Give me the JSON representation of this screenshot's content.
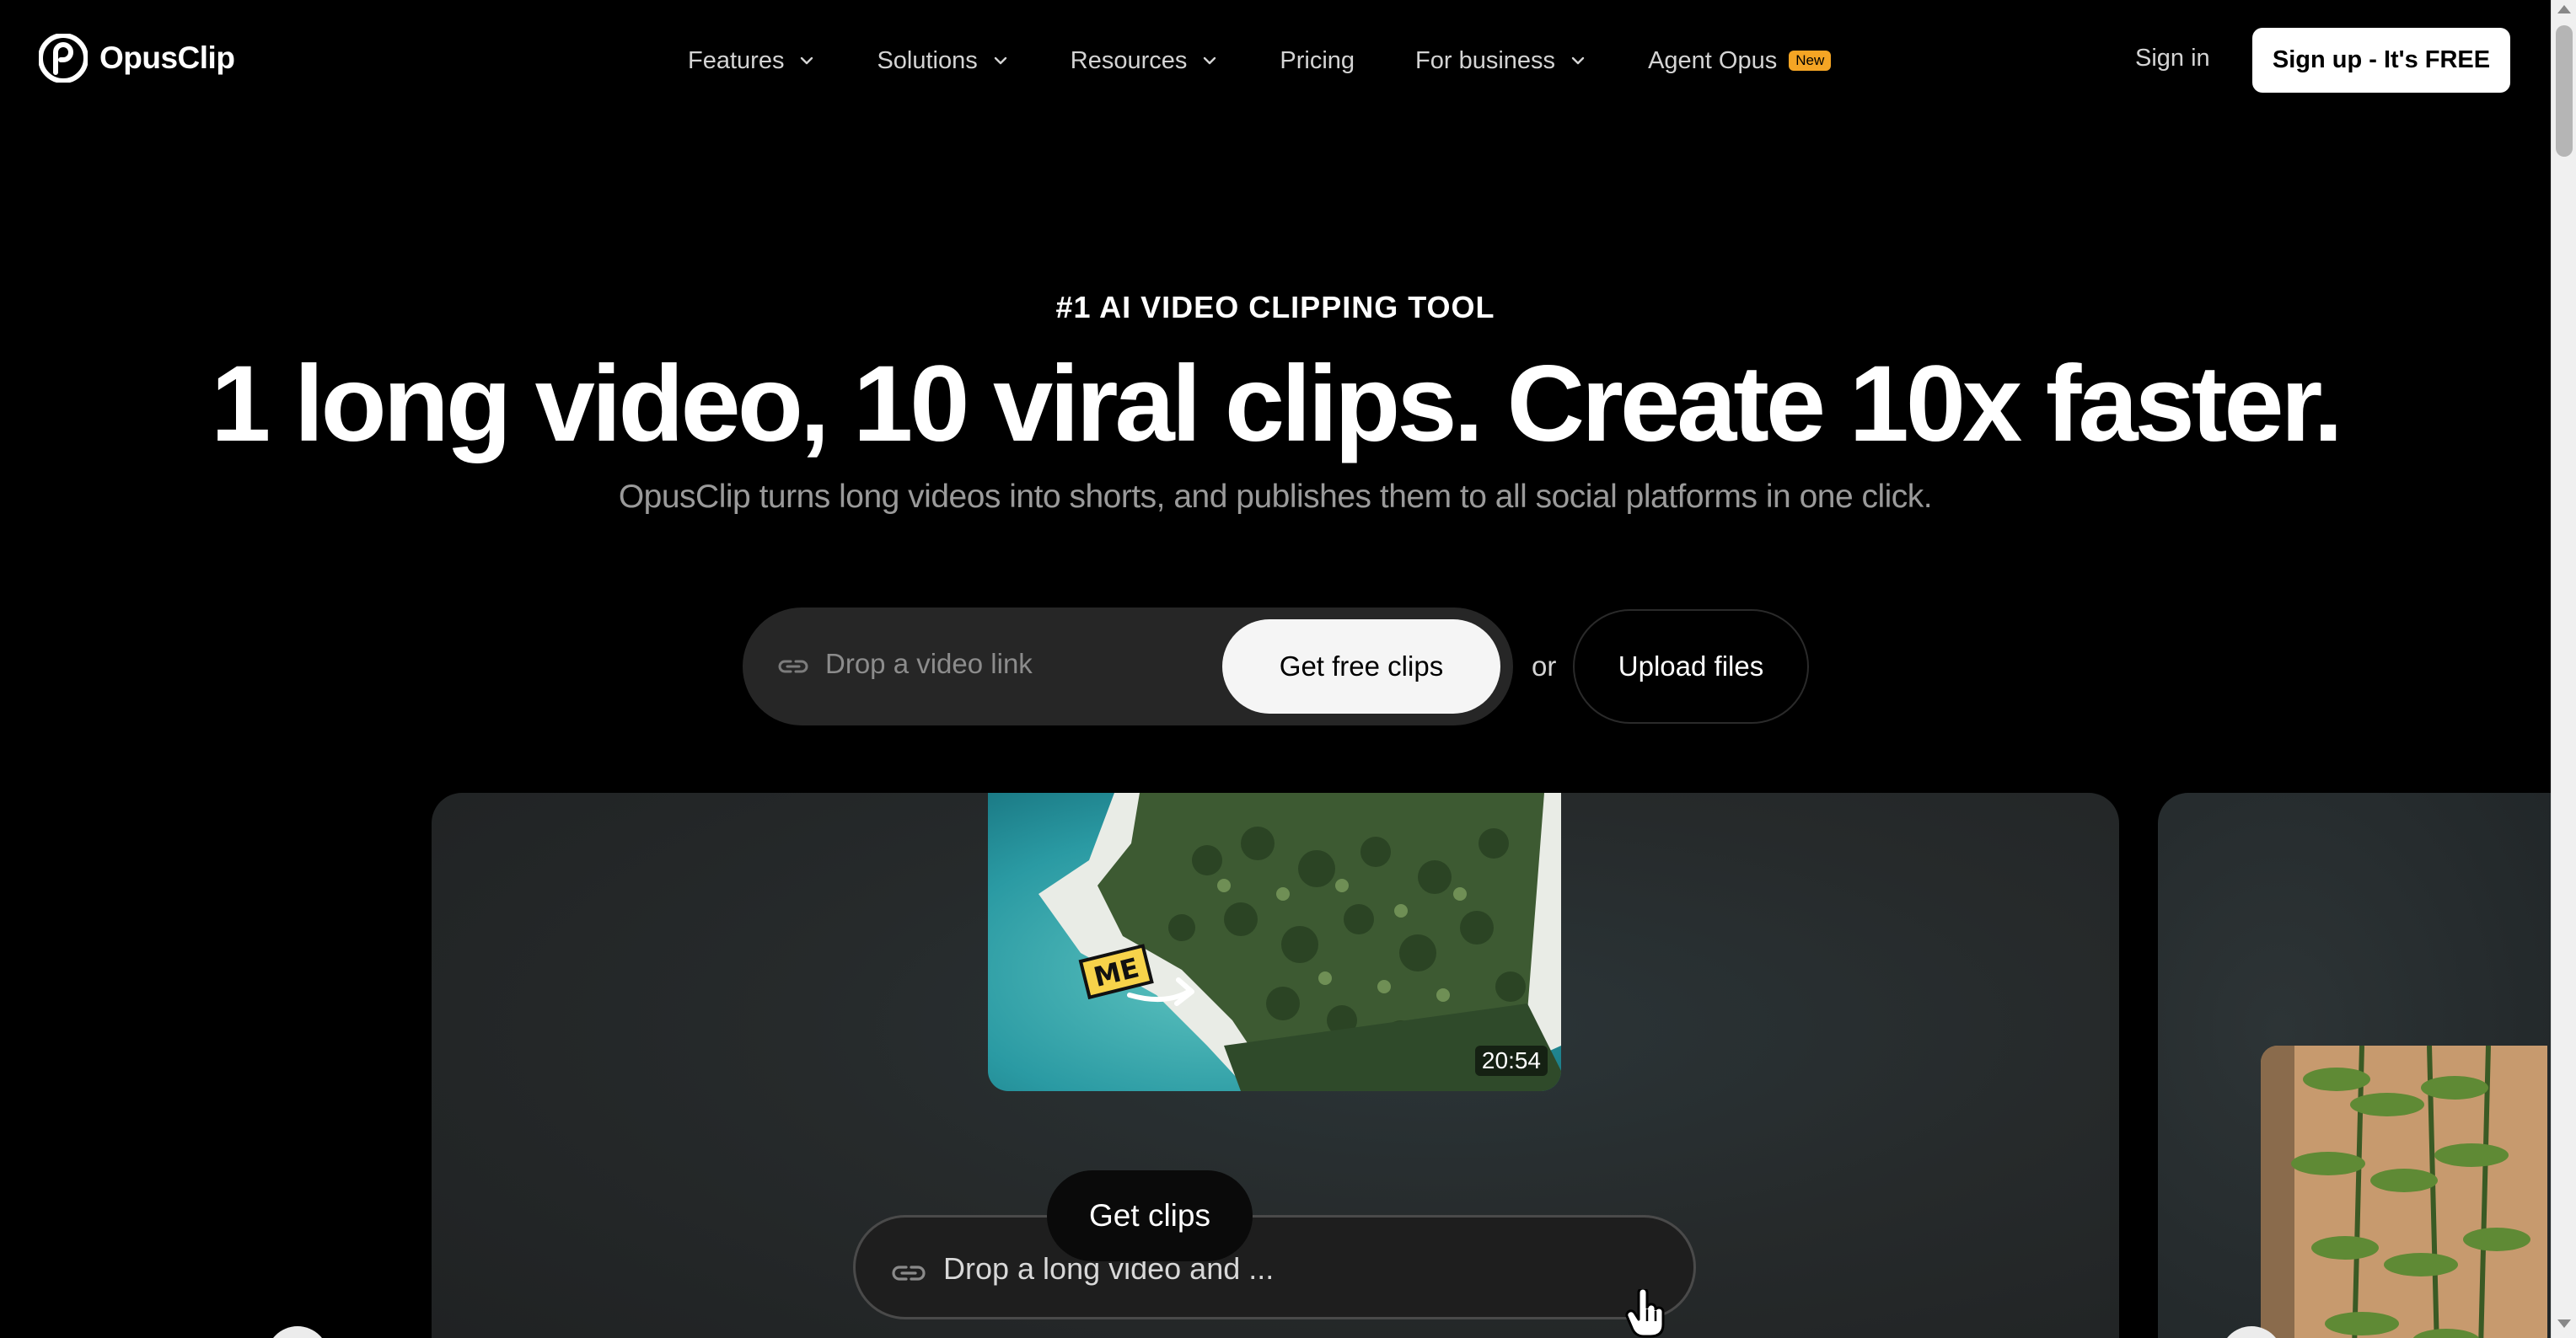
{
  "brand": {
    "name": "OpusClip",
    "logo_icon": "opusclip-logo-icon"
  },
  "nav": {
    "items": [
      {
        "label": "Features",
        "has_dropdown": true
      },
      {
        "label": "Solutions",
        "has_dropdown": true
      },
      {
        "label": "Resources",
        "has_dropdown": true
      },
      {
        "label": "Pricing",
        "has_dropdown": false
      },
      {
        "label": "For business",
        "has_dropdown": true
      },
      {
        "label": "Agent Opus",
        "has_dropdown": false,
        "badge": "New"
      }
    ],
    "signin_label": "Sign in",
    "signup_label": "Sign up - It's FREE",
    "badge_color": "#f5a524"
  },
  "hero": {
    "eyebrow": "#1 AI VIDEO CLIPPING TOOL",
    "headline": "1 long video, 10 viral clips. Create 10x faster.",
    "subhead": "OpusClip turns long videos into shorts, and publishes them to all social platforms in one click.",
    "input_placeholder": "Drop a video link",
    "primary_cta": "Get free clips",
    "or_text": "or",
    "upload_label": "Upload files"
  },
  "demo": {
    "thumbnail_label": "ME",
    "duration": "20:54",
    "input_text": "Drop a long video and ...",
    "cta": "Get clips"
  },
  "icons": {
    "link": "link-icon",
    "chevron": "chevron-down-icon",
    "cursor": "hand-pointer-icon"
  }
}
